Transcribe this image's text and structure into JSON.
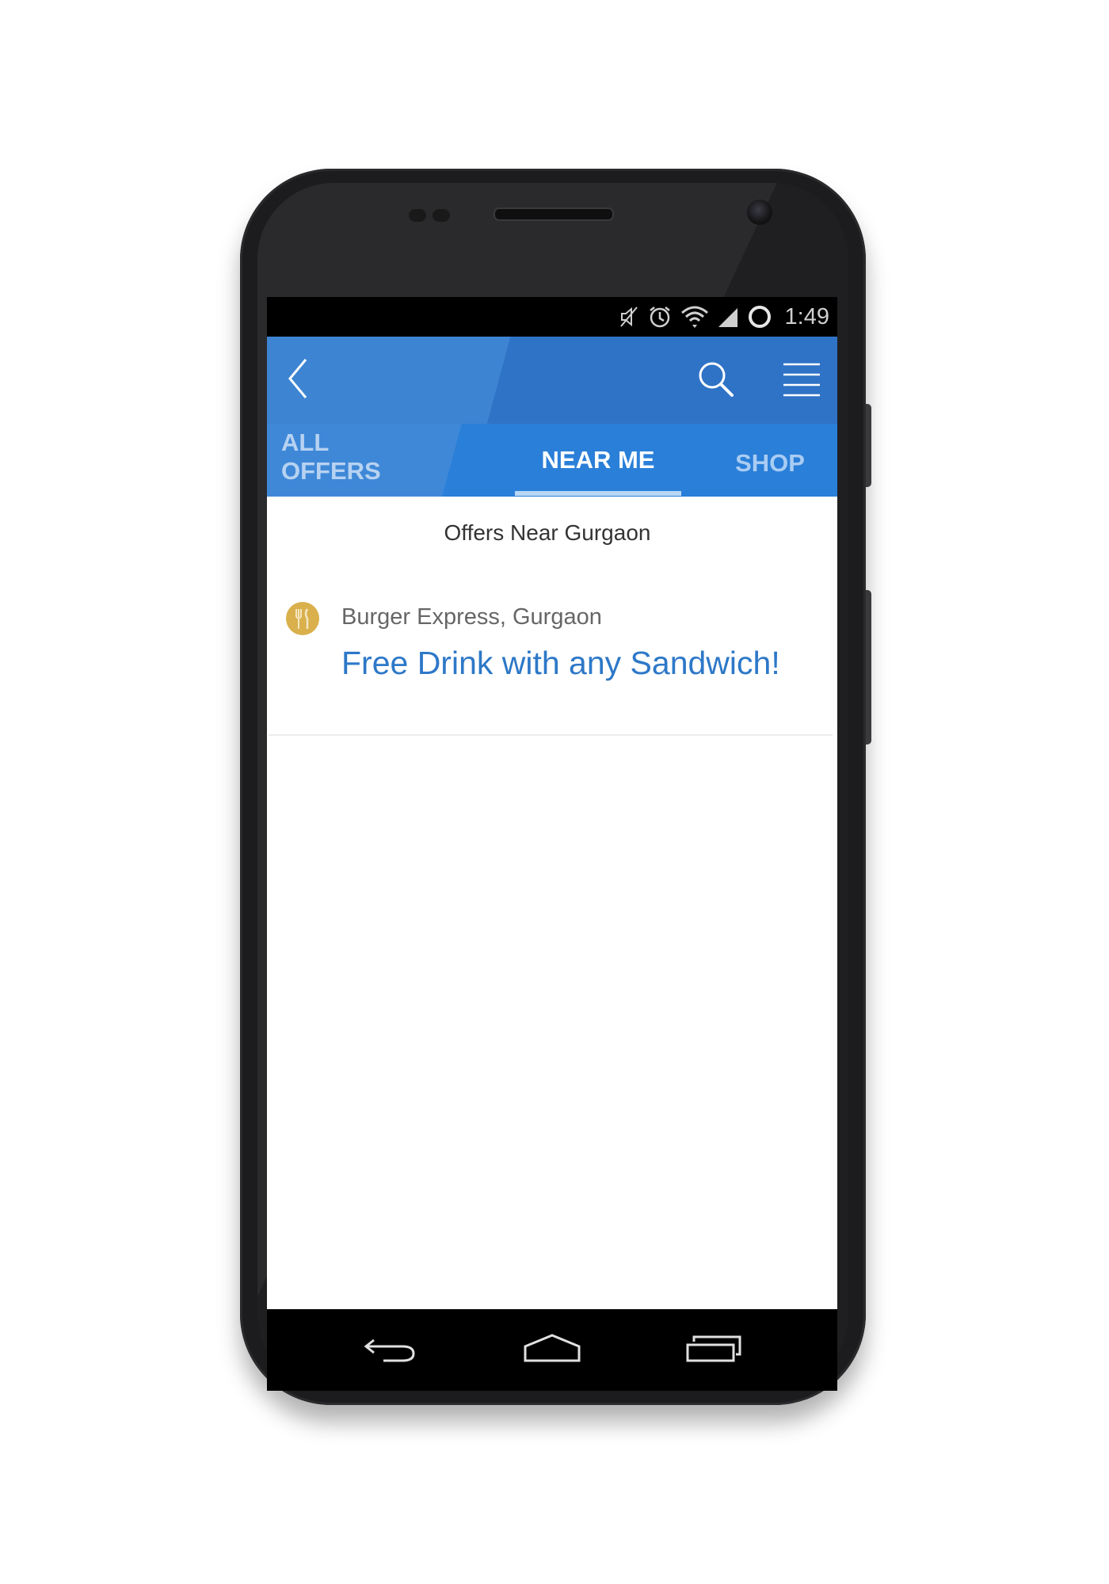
{
  "status_bar": {
    "time": "1:49",
    "icons": [
      "mute-icon",
      "alarm-icon",
      "wifi-icon",
      "signal-icon",
      "battery-ring-icon"
    ]
  },
  "app_bar": {
    "back_icon": "back-chevron-icon",
    "search_icon": "search-icon",
    "menu_icon": "menu-icon"
  },
  "tabs": [
    {
      "label": "ALL OFFERS",
      "active": false
    },
    {
      "label": "NEAR ME",
      "active": true
    },
    {
      "label": "SHOP",
      "active": false
    }
  ],
  "content": {
    "heading": "Offers Near Gurgaon",
    "offers": [
      {
        "icon": "restaurant-icon",
        "store": "Burger Express, Gurgaon",
        "title": "Free Drink with any Sandwich!"
      }
    ]
  },
  "nav_bar": {
    "buttons": [
      "back-nav-icon",
      "home-nav-icon",
      "recents-nav-icon"
    ]
  },
  "colors": {
    "app_bar": "#2f73c6",
    "tabs": "#2a7fd8",
    "offer_title": "#2d78c8",
    "offer_icon": "#d9b04c"
  }
}
